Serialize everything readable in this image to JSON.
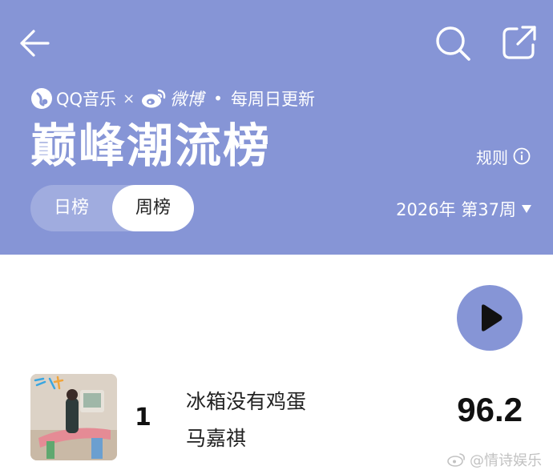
{
  "header": {
    "brand": {
      "qq_music": "QQ音乐",
      "times": "×",
      "weibo": "微博",
      "separator": "•",
      "update_note": "每周日更新"
    },
    "title": "巅峰潮流榜",
    "rules_label": "规则",
    "tabs": [
      {
        "label": "日榜",
        "selected": false
      },
      {
        "label": "周榜",
        "selected": true
      }
    ],
    "week_selector": "2026年 第37周"
  },
  "icons": {
    "back": "back-arrow-icon",
    "search": "search-icon",
    "share": "share-icon",
    "info": "info-icon",
    "dropdown": "caret-down-icon",
    "play": "play-icon"
  },
  "songs": [
    {
      "rank": "1",
      "title": "冰箱没有鸡蛋",
      "artist": "马嘉祺",
      "score": "96.2"
    }
  ],
  "watermark": "@情诗娱乐",
  "colors": {
    "header_bg": "#8695d6",
    "accent": "#8695d6",
    "text_dark": "#111111"
  }
}
